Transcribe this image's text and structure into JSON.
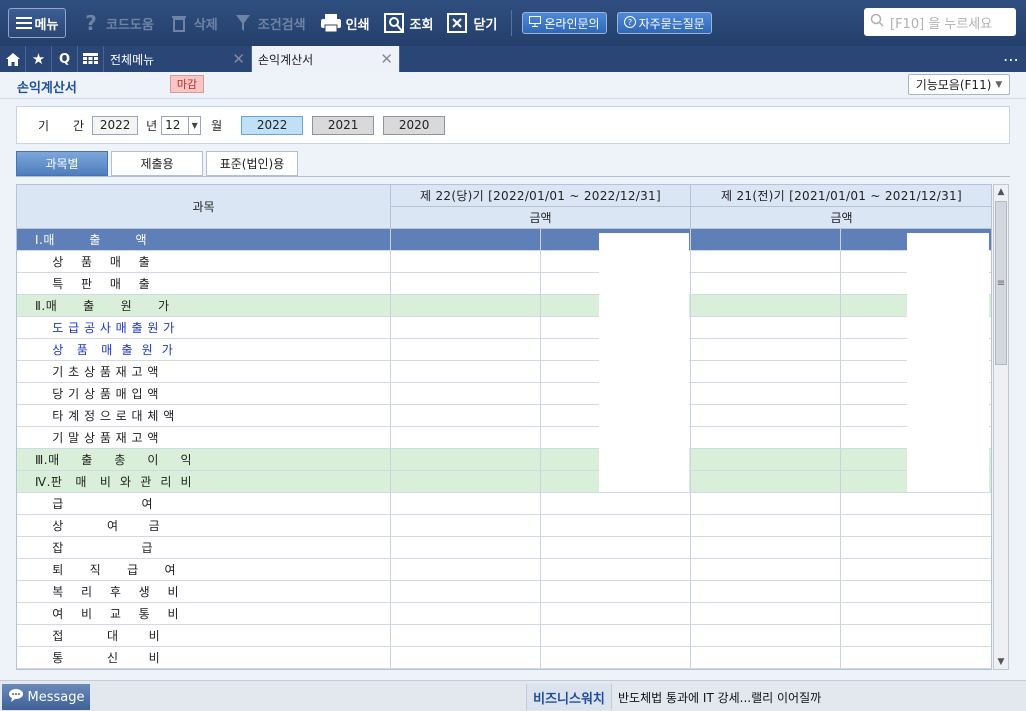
{
  "toolbar": {
    "menu": "메뉴",
    "code_help": "코드도움",
    "delete": "삭제",
    "search_cond": "조건검색",
    "print": "인쇄",
    "query": "조회",
    "close": "닫기",
    "online_inquiry": "온라인문의",
    "faq": "자주묻는질문",
    "search_placeholder": "[F10] 을 누르세요"
  },
  "tabs": [
    {
      "label": "전체메뉴"
    },
    {
      "label": "손익계산서"
    }
  ],
  "page": {
    "title": "손익계산서",
    "closed_badge": "마감",
    "functions_button": "기능모음(F11)"
  },
  "period": {
    "label_gi": "기",
    "label_gan": "간",
    "year": "2022",
    "year_suffix": "년",
    "month": "12",
    "month_suffix": "월",
    "year_buttons": [
      "2022",
      "2021",
      "2020"
    ],
    "selected_year": "2022"
  },
  "subtabs": [
    "과목별",
    "제출용",
    "표준(법인)용"
  ],
  "grid": {
    "col_account": "과목",
    "col_current": "제 22(당)기 [2022/01/01 ~ 2022/12/31]",
    "col_prior": "제 21(전)기 [2021/01/01 ~ 2021/12/31]",
    "col_amount": "금액",
    "rows": [
      {
        "text": "Ⅰ.매        출        액",
        "kind": "section1"
      },
      {
        "text": "    상    품    매    출",
        "kind": "item"
      },
      {
        "text": "    특    판    매    출",
        "kind": "item"
      },
      {
        "text": "Ⅱ.매      출      원      가",
        "kind": "green"
      },
      {
        "text": "    도 급 공 사 매 출 원 가",
        "kind": "blue"
      },
      {
        "text": "    상   품   매  출  원  가",
        "kind": "blue"
      },
      {
        "text": "    기 초 상 품 재 고 액",
        "kind": "item"
      },
      {
        "text": "    당 기 상 품 매 입 액",
        "kind": "item"
      },
      {
        "text": "    타 계 정 으 로 대 체 액",
        "kind": "item"
      },
      {
        "text": "    기 말 상 품 재 고 액",
        "kind": "item"
      },
      {
        "text": "Ⅲ.매     출     총     이     익",
        "kind": "green"
      },
      {
        "text": "Ⅳ.판   매   비  와  관  리  비",
        "kind": "green"
      },
      {
        "text": "    급                  여",
        "kind": "item"
      },
      {
        "text": "    상          여       금",
        "kind": "item"
      },
      {
        "text": "    잡                  급",
        "kind": "item"
      },
      {
        "text": "    퇴      직      급      여",
        "kind": "item"
      },
      {
        "text": "    복    리    후    생    비",
        "kind": "item"
      },
      {
        "text": "    여    비    교    통    비",
        "kind": "item"
      },
      {
        "text": "    접          대       비",
        "kind": "item"
      },
      {
        "text": "    통          신       비",
        "kind": "item"
      }
    ]
  },
  "statusbar": {
    "message": "Message",
    "biz_label": "비즈니스워치",
    "news": "반도체법  통과에 IT 강세...랠리 이어질까"
  },
  "colors": {
    "toolbar_bg": "#2a4676",
    "section_blue": "#5e7fb8",
    "section_green": "#d9efd9",
    "link_blue": "#1c34c6"
  }
}
